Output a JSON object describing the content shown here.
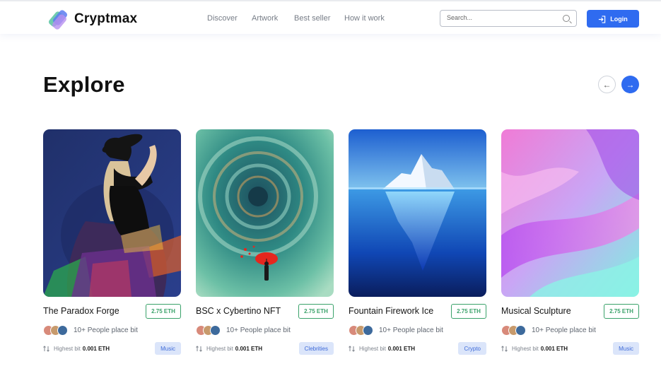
{
  "header": {
    "brand": "Cryptmax",
    "nav": [
      {
        "label": "Discover"
      },
      {
        "label": "Artwork"
      },
      {
        "label": "Best seller"
      },
      {
        "label": "How it work"
      }
    ],
    "search_placeholder": "Search...",
    "login_label": "Login"
  },
  "main": {
    "title": "Explore",
    "prev_label": "←",
    "next_label": "→"
  },
  "cards": [
    {
      "name": "The Paradox Forge",
      "price": "2.75 ETH",
      "people": "10+ People place bit",
      "bid_label": "Highest bit",
      "bid_value": "0.001 ETH",
      "tag": "Music"
    },
    {
      "name": "BSC x Cybertino NFT",
      "price": "2.75 ETH",
      "people": "10+ People place bit",
      "bid_label": "Highest bit",
      "bid_value": "0.001 ETH",
      "tag": "Clebrities"
    },
    {
      "name": "Fountain Firework Ice",
      "price": "2.75 ETH",
      "people": "10+ People place bit",
      "bid_label": "Highest bit",
      "bid_value": "0.001 ETH",
      "tag": "Crypto"
    },
    {
      "name": "Musical Sculpture",
      "price": "2.75 ETH",
      "people": "10+ People place bit",
      "bid_label": "Highest bit",
      "bid_value": "0.001 ETH",
      "tag": "Music"
    }
  ],
  "colors": {
    "accent": "#2f6bf0",
    "price_green": "#3aa26a",
    "tag_bg": "#dbe5fa",
    "tag_text": "#3e6ad8"
  }
}
